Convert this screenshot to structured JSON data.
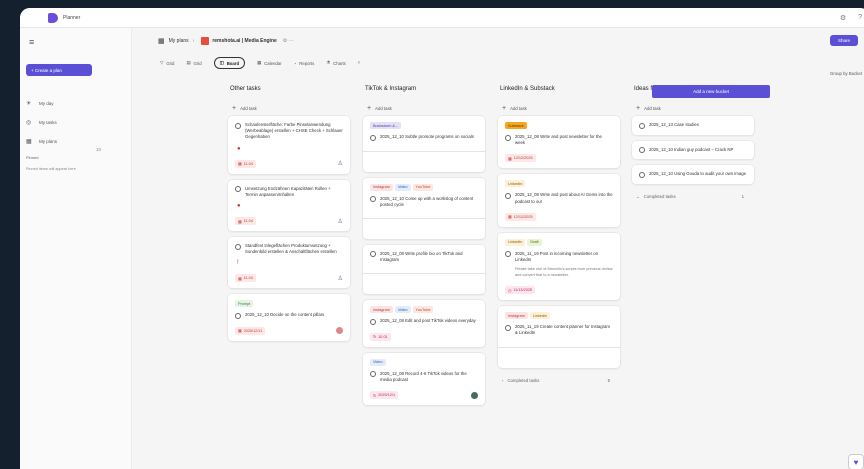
{
  "app": {
    "name": "Planner"
  },
  "window": {
    "controls": [
      "⚙",
      "?"
    ]
  },
  "nav": {
    "create_label": "+ Create a plan",
    "items": [
      {
        "icon": "☀",
        "label": "My day"
      },
      {
        "icon": "◎",
        "label": "My tasks"
      },
      {
        "icon": "▦",
        "label": "My plans"
      }
    ],
    "pinned_label": "Pinned",
    "pinned_hint": "Pinned items will appear here"
  },
  "header": {
    "breadcrumb_root": "My plans",
    "plan_title": "remshota.ai | Media Engine",
    "share_label": "Share"
  },
  "views": [
    {
      "icon": "▽",
      "label": "Grid"
    },
    {
      "icon": "▤",
      "label": "Grid"
    },
    {
      "icon": "◫",
      "label": "Board",
      "active": true
    },
    {
      "icon": "▦",
      "label": "Calendar"
    },
    {
      "icon": "◔",
      "label": "Reports"
    },
    {
      "icon": "⚗",
      "label": "Charts"
    },
    {
      "icon": "▿",
      "label": ""
    }
  ],
  "group_by": "Group by Bucket",
  "add_bucket_label": "Add a new bucket",
  "add_task_label": "Add task",
  "completed_label": "Completed tasks",
  "row_index": "10",
  "columns": [
    {
      "title": "Other tasks",
      "cards": [
        {
          "text": "Schaufensterfläche: Farbe Pinselanwendung (Werbeablage) erstellen + CHSE Check + Schlauer Gegenhaben",
          "priority": "●",
          "date": "11.04",
          "assign": "♙"
        },
        {
          "text": "Umsetzung Endzähnen Kapazitäten Rollen + Termin anpassen/Inhalten",
          "priority": "●",
          "date": "11.04",
          "assign": "♙"
        },
        {
          "text": "Standfest Inlegeflächen Produktumsetzung + Sondenbild erstellen & Anschaltflächen erstellen",
          "priority": "!",
          "date": "11.04",
          "assign": "♙"
        },
        {
          "labels": [
            {
              "text": "Prompt",
              "bg": "#e3f3e4",
              "fg": "#2e7d32"
            }
          ],
          "text": "2025_12_10 Decide on the content pillars",
          "date": "2025/12/11",
          "avatar": true
        }
      ]
    },
    {
      "title": "TikTok & Instagram",
      "cards": [
        {
          "labels": [
            {
              "text": "Brainstorm &...",
              "bg": "#e6e0f7",
              "fg": "#4b3b9a"
            }
          ],
          "text": "2025_12_10 Subtle promote programs on socials",
          "empty_footer": true
        },
        {
          "labels": [
            {
              "text": "Instagram",
              "bg": "#fde4e4",
              "fg": "#b23b3b"
            },
            {
              "text": "Video",
              "bg": "#e3ecfb",
              "fg": "#2b5aa8"
            },
            {
              "text": "YouTube",
              "bg": "#fde7e0",
              "fg": "#b2452b"
            }
          ],
          "text": "2025_12_10 Come up with a workslog of content posted cycle",
          "empty_footer": true
        },
        {
          "text": "2025_12_08 Write profile bio on TikTok and Instagram",
          "empty_footer": true
        },
        {
          "labels": [
            {
              "text": "Instagram",
              "bg": "#fde4e4",
              "fg": "#b23b3b"
            },
            {
              "text": "Video",
              "bg": "#e3ecfb",
              "fg": "#2b5aa8"
            },
            {
              "text": "YouTube",
              "bg": "#fde7e0",
              "fg": "#b2452b"
            }
          ],
          "text": "2025_12_08 Edit and post TikTok videos everyday",
          "date": "10.01"
        },
        {
          "labels": [
            {
              "text": "Video",
              "bg": "#e3ecfb",
              "fg": "#2b5aa8"
            }
          ],
          "text": "2025_12_08 Record 4-6 TikTok videos for the media podcast",
          "date": "2025/12/1",
          "avatar": true,
          "avatar_dark": true
        }
      ]
    },
    {
      "title": "LinkedIn & Substack",
      "cards": [
        {
          "labels": [
            {
              "text": "Substack",
              "bg": "#f5a623",
              "fg": "#5a3a00"
            }
          ],
          "text": "2025_12_08 Write and post newsletter for the week",
          "date": "12/12/2025"
        },
        {
          "labels": [
            {
              "text": "LinkedIn",
              "bg": "#fdf0d6",
              "fg": "#8a5a00"
            }
          ],
          "text": "2025_12_08 Write and post about AI Gems into the podcast to our",
          "date": "12/12/2025"
        },
        {
          "labels": [
            {
              "text": "LinkedIn",
              "bg": "#fdf0d6",
              "fg": "#8a5a00"
            },
            {
              "text": "Draft",
              "bg": "#eaf4d6",
              "fg": "#4a6b00"
            }
          ],
          "text": "2025_11_19 Post in incoming newsletter on LinkedIn",
          "note": "Please take one of Marcello's scripts from previous review and convert that to a newsletter.",
          "date": "11/13/2025",
          "date_style": "pink"
        },
        {
          "labels": [
            {
              "text": "Instagram",
              "bg": "#fde4e4",
              "fg": "#b23b3b"
            },
            {
              "text": "Linkedin",
              "bg": "#fdf0d6",
              "fg": "#8a5a00"
            }
          ],
          "text": "2025_11_19 Create content planner for Instagram & LinkedIn"
        }
      ]
    },
    {
      "title": "Ideas for Podcast",
      "cards": [
        {
          "text": "2025_12_13 Case studies"
        },
        {
          "text": "2025_12_10 Indian guy podcast – Crack NP"
        },
        {
          "text": "2025_12_10 Using Gouda to audit your own image"
        }
      ]
    }
  ]
}
